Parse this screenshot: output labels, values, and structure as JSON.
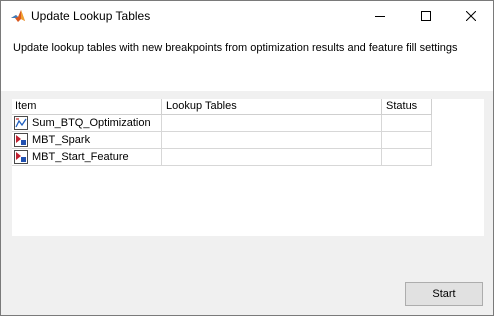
{
  "window": {
    "title": "Update Lookup Tables",
    "app_icon": "matlab-icon",
    "controls": {
      "minimize": "minimize-icon",
      "maximize": "maximize-icon",
      "close": "close-icon"
    }
  },
  "header": {
    "description": "Update lookup tables with new breakpoints from optimization results and feature fill settings"
  },
  "table": {
    "columns": [
      "Item",
      "Lookup Tables",
      "Status"
    ],
    "rows": [
      {
        "item": "Sum_BTQ_Optimization",
        "icon": "optimization-icon",
        "lookup_tables": "",
        "status": ""
      },
      {
        "item": "MBT_Spark",
        "icon": "feature-icon",
        "lookup_tables": "",
        "status": ""
      },
      {
        "item": "MBT_Start_Feature",
        "icon": "feature-icon",
        "lookup_tables": "",
        "status": ""
      }
    ]
  },
  "footer": {
    "start_label": "Start"
  }
}
